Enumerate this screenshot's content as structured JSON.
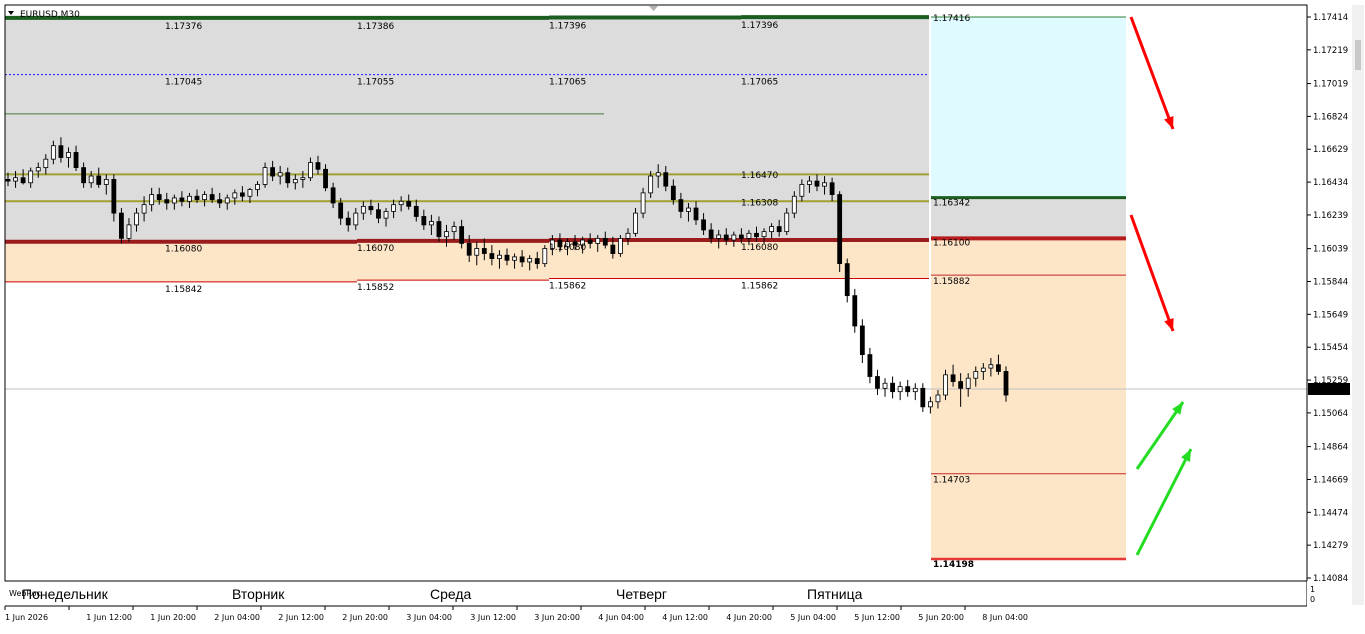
{
  "header": {
    "symbol": "EURUSD,M30"
  },
  "chart_data": {
    "type": "candlestick",
    "symbol": "EURUSD,M30",
    "ylim": [
      1.14084,
      1.17414
    ],
    "current_price": 1.15206,
    "price_ticks": [
      {
        "v": 1.17414,
        "t": "1.17414"
      },
      {
        "v": 1.17219,
        "t": "1.17219"
      },
      {
        "v": 1.17019,
        "t": "1.17019"
      },
      {
        "v": 1.16824,
        "t": "1.16824"
      },
      {
        "v": 1.16629,
        "t": "1.16629"
      },
      {
        "v": 1.16434,
        "t": "1.16434"
      },
      {
        "v": 1.16239,
        "t": "1.16239"
      },
      {
        "v": 1.16039,
        "t": "1.16039"
      },
      {
        "v": 1.15844,
        "t": "1.15844"
      },
      {
        "v": 1.15649,
        "t": "1.15649"
      },
      {
        "v": 1.15454,
        "t": "1.15454"
      },
      {
        "v": 1.15259,
        "t": "1.15259"
      },
      {
        "v": 1.15064,
        "t": "1.15064"
      },
      {
        "v": 1.14864,
        "t": "1.14864"
      },
      {
        "v": 1.14669,
        "t": "1.14669"
      },
      {
        "v": 1.14474,
        "t": "1.14474"
      },
      {
        "v": 1.14279,
        "t": "1.14279"
      },
      {
        "v": 1.14084,
        "t": "1.14084"
      }
    ],
    "time_ticks": [
      "1 Jun 2026",
      "1 Jun 12:00",
      "1 Jun 20:00",
      "2 Jun 04:00",
      "2 Jun 12:00",
      "2 Jun 20:00",
      "3 Jun 04:00",
      "3 Jun 12:00",
      "3 Jun 20:00",
      "4 Jun 04:00",
      "4 Jun 12:00",
      "4 Jun 20:00",
      "5 Jun 04:00",
      "5 Jun 12:00",
      "5 Jun 20:00",
      "8 Jun 04:00"
    ],
    "days": [
      "Понедельник",
      "Вторник",
      "Среда",
      "Четверг",
      "Пятница"
    ],
    "day_segments": [
      {
        "levels": [
          {
            "value": 1.17409,
            "label": "1.17376",
            "kind": "top"
          },
          {
            "value": 1.17072,
            "label": "1.17045",
            "kind": "blue"
          },
          {
            "value": 1.1608,
            "label": "1.16080",
            "kind": "red-thick"
          },
          {
            "value": 1.15842,
            "label": "1.15842",
            "kind": "red-thin"
          }
        ]
      },
      {
        "levels": [
          {
            "value": 1.17409,
            "label": "1.17386",
            "kind": "top"
          },
          {
            "value": 1.17072,
            "label": "1.17055",
            "kind": "blue"
          },
          {
            "value": 1.16085,
            "label": "1.16070",
            "kind": "red-thick"
          },
          {
            "value": 1.15852,
            "label": "1.15852",
            "kind": "red-thin"
          }
        ]
      },
      {
        "levels": [
          {
            "value": 1.17411,
            "label": "1.17396",
            "kind": "top"
          },
          {
            "value": 1.17072,
            "label": "1.17065",
            "kind": "blue"
          },
          {
            "value": 1.1609,
            "label": "1.16080",
            "kind": "red-thick"
          },
          {
            "value": 1.15862,
            "label": "1.15862",
            "kind": "red-thin"
          }
        ]
      },
      {
        "levels": [
          {
            "value": 1.17413,
            "label": "1.17396",
            "kind": "top"
          },
          {
            "value": 1.17072,
            "label": "1.17065",
            "kind": "blue"
          },
          {
            "value": 1.1647,
            "label": "1.16470",
            "kind": "olive-label"
          },
          {
            "value": 1.16308,
            "label": "1.16308",
            "kind": "olive-label"
          },
          {
            "value": 1.1609,
            "label": "1.16080",
            "kind": "red-thick"
          },
          {
            "value": 1.15862,
            "label": "1.15862",
            "kind": "red-thin"
          }
        ]
      }
    ],
    "projection_levels": [
      {
        "value": 1.17414,
        "label": "1.17416",
        "color": "#2e7d32"
      },
      {
        "value": 1.16342,
        "label": "1.16342",
        "color": "#1b5e20"
      },
      {
        "value": 1.161,
        "label": "1.16100",
        "color": "#b71c1c"
      },
      {
        "value": 1.15882,
        "label": "1.15882",
        "color": "#c62828"
      },
      {
        "value": 1.14703,
        "label": "1.14703",
        "color": "#c62828"
      },
      {
        "value": 1.14198,
        "label": "1.14198",
        "color": "#e53935"
      },
      {
        "value": 1.14192,
        "label": "1.14192",
        "color": "#e53935"
      }
    ],
    "olive_levels": [
      1.1648,
      1.1632
    ],
    "green_mid_level": 1.16839,
    "candles": [
      [
        1.1645,
        1.1649,
        1.1641,
        1.1644
      ],
      [
        1.1644,
        1.165,
        1.164,
        1.1646
      ],
      [
        1.1646,
        1.1651,
        1.1642,
        1.1643
      ],
      [
        1.1643,
        1.1652,
        1.164,
        1.165
      ],
      [
        1.165,
        1.1655,
        1.1646,
        1.1652
      ],
      [
        1.1652,
        1.166,
        1.1648,
        1.1657
      ],
      [
        1.1657,
        1.1668,
        1.1654,
        1.1665
      ],
      [
        1.1665,
        1.167,
        1.1655,
        1.1658
      ],
      [
        1.1658,
        1.1664,
        1.1652,
        1.1661
      ],
      [
        1.1661,
        1.1665,
        1.165,
        1.1652
      ],
      [
        1.1652,
        1.1655,
        1.164,
        1.1643
      ],
      [
        1.1643,
        1.165,
        1.164,
        1.1647
      ],
      [
        1.1647,
        1.1652,
        1.164,
        1.1642
      ],
      [
        1.1642,
        1.1648,
        1.1636,
        1.1645
      ],
      [
        1.1645,
        1.1648,
        1.162,
        1.1625
      ],
      [
        1.1625,
        1.1628,
        1.1607,
        1.161
      ],
      [
        1.161,
        1.1622,
        1.1608,
        1.1618
      ],
      [
        1.1618,
        1.1628,
        1.1614,
        1.1625
      ],
      [
        1.1625,
        1.1635,
        1.162,
        1.163
      ],
      [
        1.163,
        1.164,
        1.1626,
        1.1636
      ],
      [
        1.1636,
        1.164,
        1.163,
        1.1633
      ],
      [
        1.1633,
        1.1637,
        1.1627,
        1.1631
      ],
      [
        1.1631,
        1.1636,
        1.1627,
        1.1634
      ],
      [
        1.1634,
        1.1638,
        1.1629,
        1.1632
      ],
      [
        1.1632,
        1.1637,
        1.1628,
        1.1635
      ],
      [
        1.1635,
        1.1639,
        1.1631,
        1.1633
      ],
      [
        1.1633,
        1.1638,
        1.1629,
        1.1636
      ],
      [
        1.1636,
        1.164,
        1.1631,
        1.1633
      ],
      [
        1.1633,
        1.1637,
        1.1628,
        1.1631
      ],
      [
        1.1631,
        1.1636,
        1.1627,
        1.1634
      ],
      [
        1.1634,
        1.1639,
        1.163,
        1.1637
      ],
      [
        1.1637,
        1.1641,
        1.1632,
        1.1635
      ],
      [
        1.1635,
        1.164,
        1.1631,
        1.1639
      ],
      [
        1.1639,
        1.1644,
        1.1635,
        1.1642
      ],
      [
        1.1642,
        1.1655,
        1.164,
        1.1652
      ],
      [
        1.1652,
        1.1656,
        1.1644,
        1.1647
      ],
      [
        1.1647,
        1.1653,
        1.1642,
        1.1649
      ],
      [
        1.1649,
        1.1652,
        1.164,
        1.1643
      ],
      [
        1.1643,
        1.1648,
        1.1639,
        1.1645
      ],
      [
        1.1645,
        1.165,
        1.164,
        1.1646
      ],
      [
        1.1646,
        1.1658,
        1.1644,
        1.1655
      ],
      [
        1.1655,
        1.1659,
        1.1648,
        1.1651
      ],
      [
        1.1651,
        1.1654,
        1.1638,
        1.164
      ],
      [
        1.164,
        1.1643,
        1.1628,
        1.1631
      ],
      [
        1.1631,
        1.1634,
        1.1618,
        1.1622
      ],
      [
        1.1622,
        1.1626,
        1.1614,
        1.1618
      ],
      [
        1.1618,
        1.1628,
        1.1615,
        1.1625
      ],
      [
        1.1625,
        1.1632,
        1.1621,
        1.1629
      ],
      [
        1.1629,
        1.1633,
        1.1624,
        1.1627
      ],
      [
        1.1627,
        1.1631,
        1.1619,
        1.1622
      ],
      [
        1.1622,
        1.1628,
        1.1617,
        1.1626
      ],
      [
        1.1626,
        1.1633,
        1.1622,
        1.163
      ],
      [
        1.163,
        1.1635,
        1.1626,
        1.1632
      ],
      [
        1.1632,
        1.1636,
        1.1627,
        1.1629
      ],
      [
        1.1629,
        1.1633,
        1.162,
        1.1623
      ],
      [
        1.1623,
        1.1627,
        1.1615,
        1.1618
      ],
      [
        1.1618,
        1.1624,
        1.1612,
        1.162
      ],
      [
        1.162,
        1.1623,
        1.1608,
        1.1611
      ],
      [
        1.1611,
        1.1618,
        1.1605,
        1.1614
      ],
      [
        1.1614,
        1.162,
        1.1609,
        1.1617
      ],
      [
        1.1617,
        1.1621,
        1.1604,
        1.1607
      ],
      [
        1.1607,
        1.1612,
        1.1596,
        1.16
      ],
      [
        1.16,
        1.1608,
        1.1594,
        1.1604
      ],
      [
        1.1604,
        1.161,
        1.1597,
        1.1601
      ],
      [
        1.1601,
        1.1606,
        1.1594,
        1.1598
      ],
      [
        1.1598,
        1.1603,
        1.1592,
        1.16
      ],
      [
        1.16,
        1.1604,
        1.1594,
        1.1597
      ],
      [
        1.1597,
        1.1601,
        1.1592,
        1.1599
      ],
      [
        1.1599,
        1.1603,
        1.1593,
        1.1596
      ],
      [
        1.1596,
        1.16,
        1.1591,
        1.1598
      ],
      [
        1.1598,
        1.1602,
        1.1592,
        1.1595
      ],
      [
        1.1595,
        1.1606,
        1.1593,
        1.1604
      ],
      [
        1.1604,
        1.1612,
        1.16,
        1.1609
      ],
      [
        1.1609,
        1.1613,
        1.1602,
        1.1605
      ],
      [
        1.1605,
        1.161,
        1.16,
        1.1608
      ],
      [
        1.1608,
        1.1612,
        1.1603,
        1.1606
      ],
      [
        1.1606,
        1.1611,
        1.1601,
        1.1609
      ],
      [
        1.1609,
        1.1613,
        1.1604,
        1.1607
      ],
      [
        1.1607,
        1.1612,
        1.1602,
        1.161
      ],
      [
        1.161,
        1.1614,
        1.1604,
        1.1606
      ],
      [
        1.1606,
        1.1611,
        1.1598,
        1.1601
      ],
      [
        1.1601,
        1.1612,
        1.1599,
        1.161
      ],
      [
        1.161,
        1.1616,
        1.1606,
        1.1613
      ],
      [
        1.1613,
        1.1628,
        1.1611,
        1.1625
      ],
      [
        1.1625,
        1.164,
        1.1622,
        1.1637
      ],
      [
        1.1637,
        1.165,
        1.1634,
        1.1647
      ],
      [
        1.1647,
        1.1654,
        1.164,
        1.1649
      ],
      [
        1.1649,
        1.1653,
        1.1638,
        1.1641
      ],
      [
        1.1641,
        1.1645,
        1.163,
        1.1633
      ],
      [
        1.1633,
        1.1637,
        1.1622,
        1.1626
      ],
      [
        1.1626,
        1.1631,
        1.162,
        1.1628
      ],
      [
        1.1628,
        1.1632,
        1.1618,
        1.1621
      ],
      [
        1.1621,
        1.1625,
        1.1612,
        1.1615
      ],
      [
        1.1615,
        1.1619,
        1.1607,
        1.161
      ],
      [
        1.161,
        1.1615,
        1.1604,
        1.1612
      ],
      [
        1.1612,
        1.1616,
        1.1606,
        1.1609
      ],
      [
        1.1609,
        1.1614,
        1.1605,
        1.1612
      ],
      [
        1.1612,
        1.1616,
        1.1607,
        1.161
      ],
      [
        1.161,
        1.1615,
        1.1606,
        1.1613
      ],
      [
        1.1613,
        1.1617,
        1.1608,
        1.1611
      ],
      [
        1.1611,
        1.1616,
        1.1607,
        1.1614
      ],
      [
        1.1614,
        1.1619,
        1.161,
        1.1617
      ],
      [
        1.1617,
        1.1621,
        1.1611,
        1.1614
      ],
      [
        1.1614,
        1.1628,
        1.1612,
        1.1625
      ],
      [
        1.1625,
        1.1638,
        1.1622,
        1.1635
      ],
      [
        1.1635,
        1.1645,
        1.1632,
        1.1642
      ],
      [
        1.1642,
        1.1647,
        1.1637,
        1.1644
      ],
      [
        1.1644,
        1.1648,
        1.1638,
        1.1641
      ],
      [
        1.1641,
        1.1647,
        1.1636,
        1.1643
      ],
      [
        1.1643,
        1.1646,
        1.1632,
        1.1636
      ],
      [
        1.1636,
        1.1638,
        1.159,
        1.1595
      ],
      [
        1.1595,
        1.1598,
        1.1572,
        1.1576
      ],
      [
        1.1576,
        1.158,
        1.1554,
        1.1558
      ],
      [
        1.1558,
        1.1562,
        1.1536,
        1.1541
      ],
      [
        1.1541,
        1.1545,
        1.1524,
        1.1528
      ],
      [
        1.1528,
        1.1532,
        1.1517,
        1.1521
      ],
      [
        1.1521,
        1.1527,
        1.1516,
        1.1524
      ],
      [
        1.1524,
        1.1528,
        1.1515,
        1.1519
      ],
      [
        1.1519,
        1.1525,
        1.1514,
        1.1522
      ],
      [
        1.1522,
        1.1526,
        1.1516,
        1.1519
      ],
      [
        1.1519,
        1.1524,
        1.1514,
        1.1521
      ],
      [
        1.1521,
        1.1524,
        1.1507,
        1.151
      ],
      [
        1.151,
        1.1516,
        1.1506,
        1.1513
      ],
      [
        1.1513,
        1.152,
        1.1509,
        1.1517
      ],
      [
        1.1517,
        1.1532,
        1.1514,
        1.1529
      ],
      [
        1.1529,
        1.1535,
        1.1522,
        1.1525
      ],
      [
        1.1525,
        1.153,
        1.151,
        1.1521
      ],
      [
        1.1521,
        1.153,
        1.1516,
        1.1527
      ],
      [
        1.1527,
        1.1534,
        1.1522,
        1.1531
      ],
      [
        1.1531,
        1.1536,
        1.1526,
        1.1533
      ],
      [
        1.1533,
        1.1539,
        1.1528,
        1.1535
      ],
      [
        1.1535,
        1.1541,
        1.1529,
        1.1531
      ],
      [
        1.1531,
        1.1534,
        1.1513,
        1.1517
      ]
    ],
    "arrows": [
      {
        "direction": "down",
        "color": "#ff0000"
      },
      {
        "direction": "down",
        "color": "#ff0000"
      },
      {
        "direction": "up",
        "color": "#22dd22"
      },
      {
        "direction": "up",
        "color": "#22dd22"
      }
    ],
    "footer_label": "WebRoc"
  },
  "colors": {
    "grey_zone": "#dcdcdc",
    "peach_zone": "#fde5c8",
    "cyan_zone": "#e0fbff",
    "top_line": "#1b5e20",
    "blue_dotted": "#1a1aff",
    "olive": "#a0a030",
    "red_thick": "#9b1c1c",
    "red_thin": "#cc0000",
    "bull": "#000000",
    "bear": "#000000"
  }
}
